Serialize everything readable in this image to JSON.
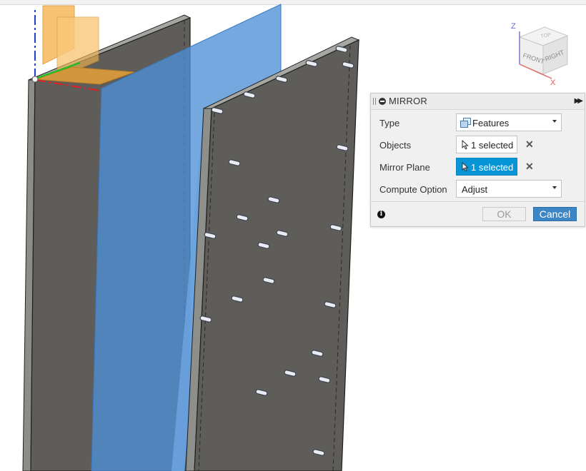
{
  "viewcube": {
    "front": "FRONT",
    "right": "RIGHT",
    "top": "TOP",
    "axis_z": "Z",
    "axis_x": "X"
  },
  "dialog": {
    "title": "MIRROR",
    "rows": [
      {
        "label": "Type",
        "value": "Features",
        "control": "dropdown",
        "icon": "features-icon"
      },
      {
        "label": "Objects",
        "value": "1 selected",
        "control": "selection",
        "icon": "cursor-icon"
      },
      {
        "label": "Mirror Plane",
        "value": "1 selected",
        "control": "selection-active",
        "icon": "cursor-icon"
      },
      {
        "label": "Compute Option",
        "value": "Adjust",
        "control": "dropdown"
      }
    ],
    "ok_label": "OK",
    "cancel_label": "Cancel"
  },
  "colors": {
    "panel": "#5e5e5c",
    "panel_edge": "#8f8f8b",
    "mirror_plane": "#4d8fd6",
    "origin_plane": "#f4a83a",
    "axis_x": "#e02020",
    "axis_y": "#22c022",
    "axis_z": "#1f3fd0",
    "active_selection": "#0696d7",
    "cancel_button": "#3d86c6"
  }
}
